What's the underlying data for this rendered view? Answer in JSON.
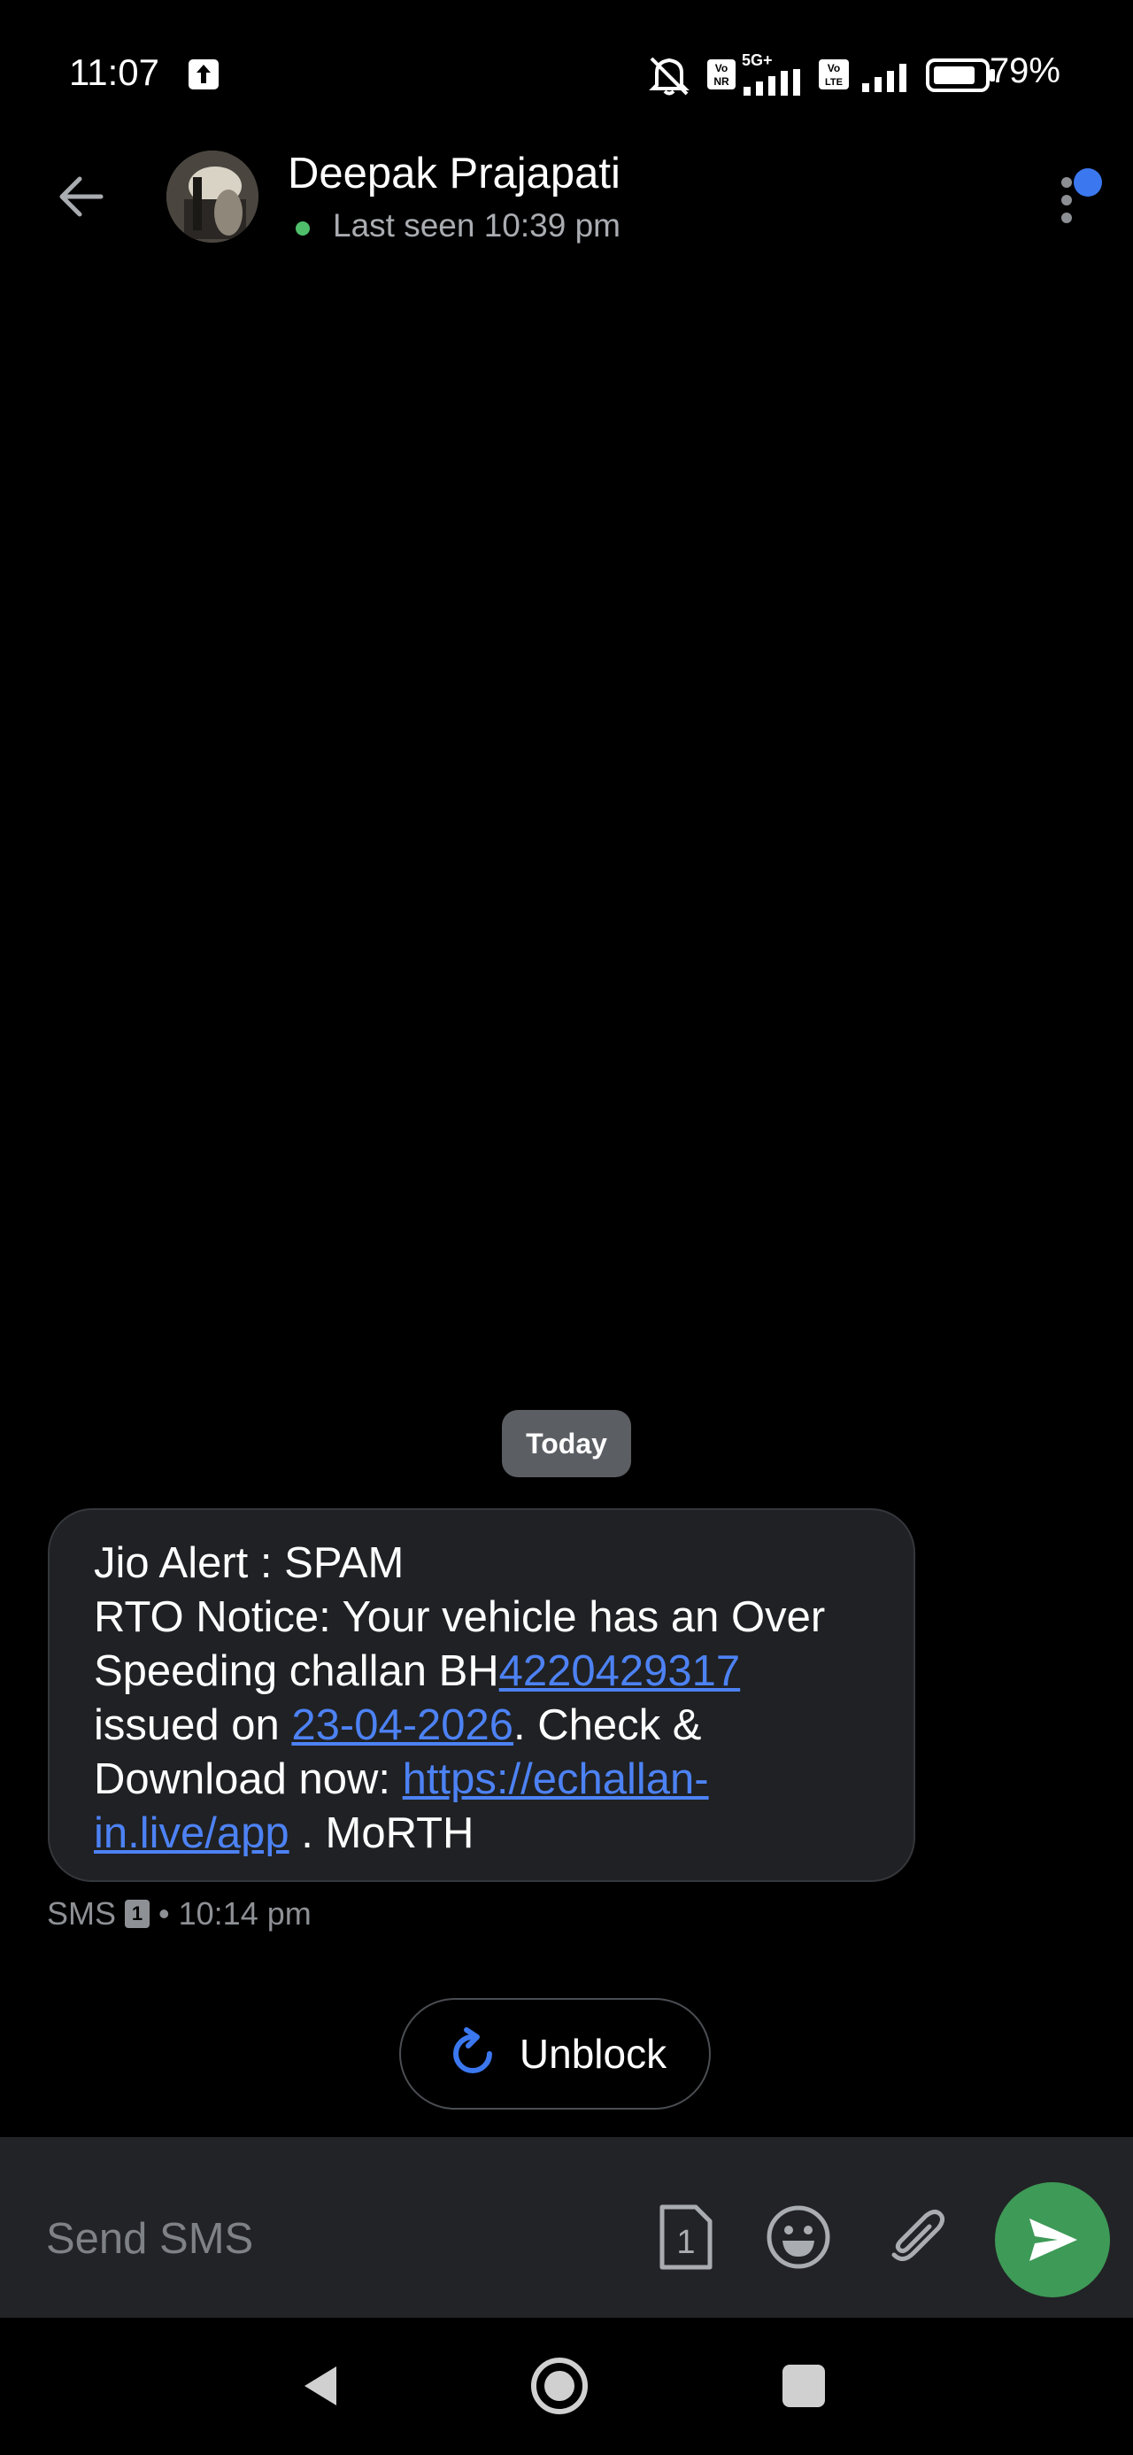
{
  "status_bar": {
    "time": "11:07",
    "battery": "79%",
    "network_label": "5G+",
    "icons": [
      "upload-icon",
      "silent-icon",
      "volte-nr-icon",
      "signal-icon",
      "volte-lte-icon",
      "signal-icon",
      "battery-icon"
    ]
  },
  "header": {
    "contact_name": "Deepak Prajapati",
    "last_seen": "Last seen 10:39 pm",
    "online_color": "#4fbf6b",
    "menu_badge_color": "#3b78f0"
  },
  "chat": {
    "date_chip": "Today",
    "message": {
      "line1": "Jio Alert : SPAM",
      "part1": "RTO Notice: Your vehicle has an Over Speeding challan BH",
      "challan_number": "4220429317",
      "part2": " issued on ",
      "date_link": "23-04-2026",
      "part3": ". Check & Download now: ",
      "url": "https://echallan-in.live/app",
      "part4": " . MoRTH",
      "link_color": "#4d82f4"
    },
    "meta": {
      "channel": "SMS",
      "sim": "1",
      "separator": "•",
      "time": "10:14 pm"
    },
    "unblock_label": "Unblock"
  },
  "composer": {
    "placeholder": "Send SMS",
    "sim_label": "1",
    "send_color": "#3e9a57"
  }
}
